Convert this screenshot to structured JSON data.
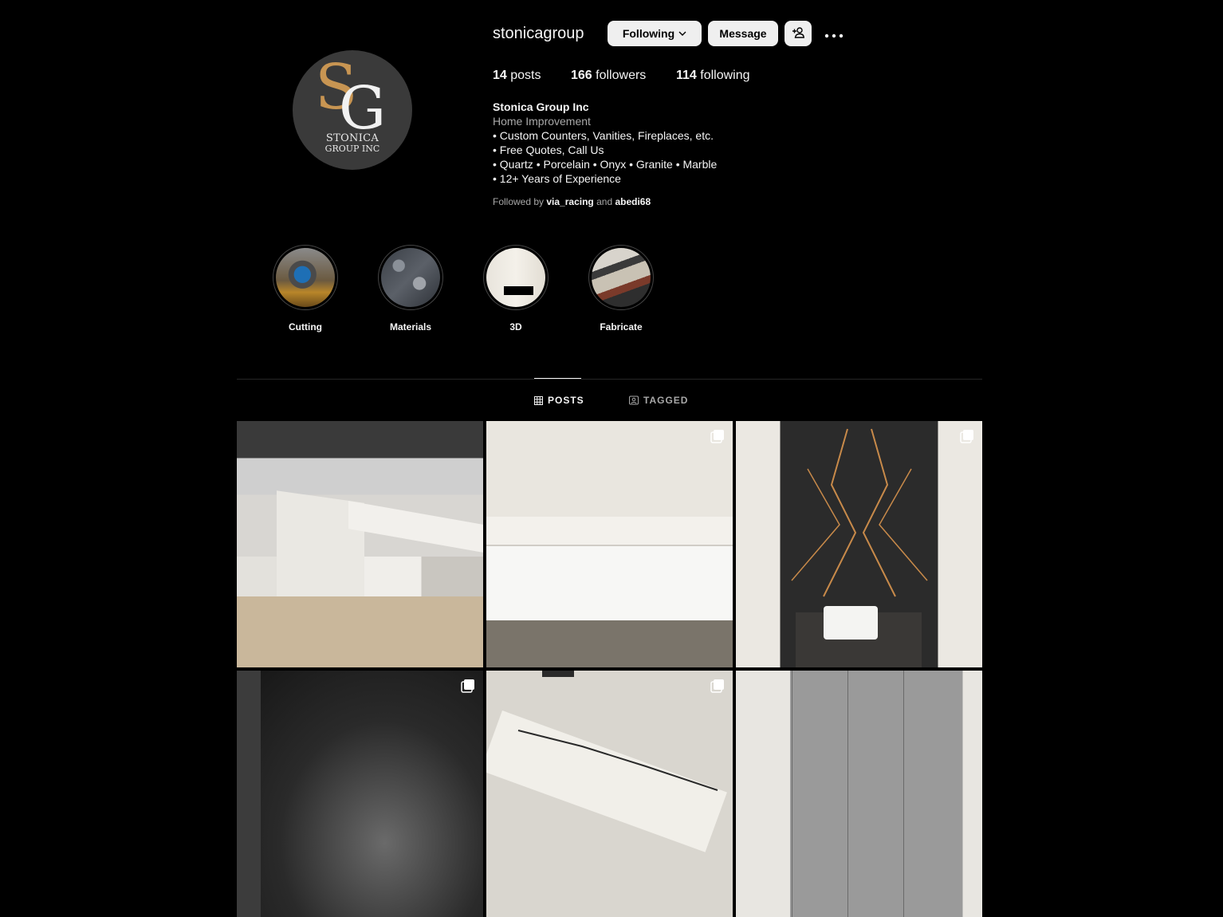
{
  "profile": {
    "username": "stonicagroup",
    "logo": {
      "initials_1": "S",
      "initials_2": "G",
      "line1": "STONICA",
      "line2": "GROUP INC",
      "gold": "#c89552"
    },
    "buttons": {
      "following": "Following",
      "message": "Message"
    },
    "stats": [
      {
        "count": "14",
        "label": "posts"
      },
      {
        "count": "166",
        "label": "followers"
      },
      {
        "count": "114",
        "label": "following"
      }
    ],
    "bio": {
      "name": "Stonica Group Inc",
      "category": "Home Improvement",
      "lines": [
        "• Custom Counters, Vanities, Fireplaces, etc.",
        "• Free Quotes, Call Us",
        "• Quartz • Porcelain • Onyx • Granite • Marble",
        "• 12+ Years of Experience"
      ]
    },
    "followed_by": {
      "prefix": "Followed by",
      "user1": "via_racing",
      "joiner": "and",
      "user2": "abedi68"
    }
  },
  "highlights": [
    {
      "label": "Cutting"
    },
    {
      "label": "Materials"
    },
    {
      "label": "3D"
    },
    {
      "label": "Fabricate"
    }
  ],
  "tabs": {
    "posts": "POSTS",
    "tagged": "TAGGED"
  },
  "posts": [
    {
      "name": "kitchen-island-marble",
      "multi": false
    },
    {
      "name": "white-vanity-counter",
      "multi": true
    },
    {
      "name": "gold-vein-wall-vanity",
      "multi": true
    },
    {
      "name": "dark-marble-wall",
      "multi": true
    },
    {
      "name": "white-countertop-veins",
      "multi": true
    },
    {
      "name": "grey-cabinets",
      "multi": false
    }
  ]
}
